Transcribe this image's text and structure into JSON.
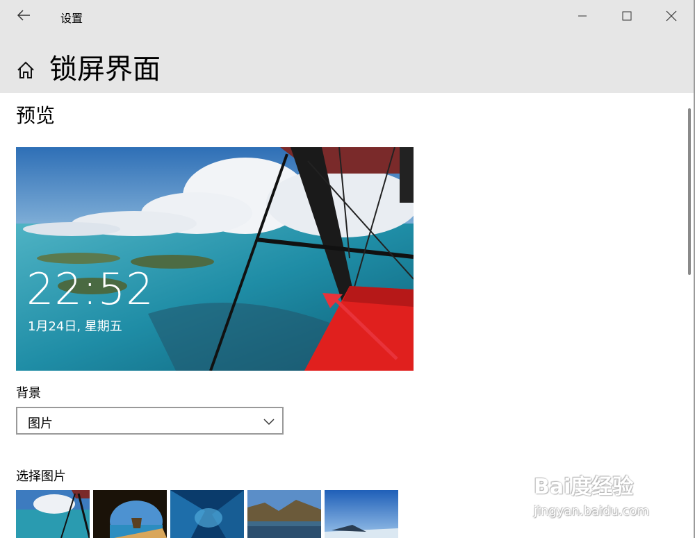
{
  "window": {
    "app_title": "设置",
    "page_title": "锁屏界面"
  },
  "preview": {
    "heading": "预览",
    "time": "22:52",
    "date": "1月24日, 星期五"
  },
  "background": {
    "label": "背景",
    "selected": "图片"
  },
  "choose_picture": {
    "label": "选择图片",
    "thumbnails": [
      "sea-plane",
      "cave-beach",
      "ice-cave",
      "mountain-lake",
      "blue-sky"
    ]
  },
  "watermark": {
    "logo": "Bai度经验",
    "url": "jingyan.baidu.com"
  },
  "icons": [
    "back-icon",
    "minimize-icon",
    "maximize-icon",
    "close-icon",
    "home-icon",
    "chevron-down-icon"
  ],
  "colors": {
    "titlebar": "#e6e6e6",
    "annotation_arrow": "#e8333a",
    "dropdown_border": "#999999"
  }
}
